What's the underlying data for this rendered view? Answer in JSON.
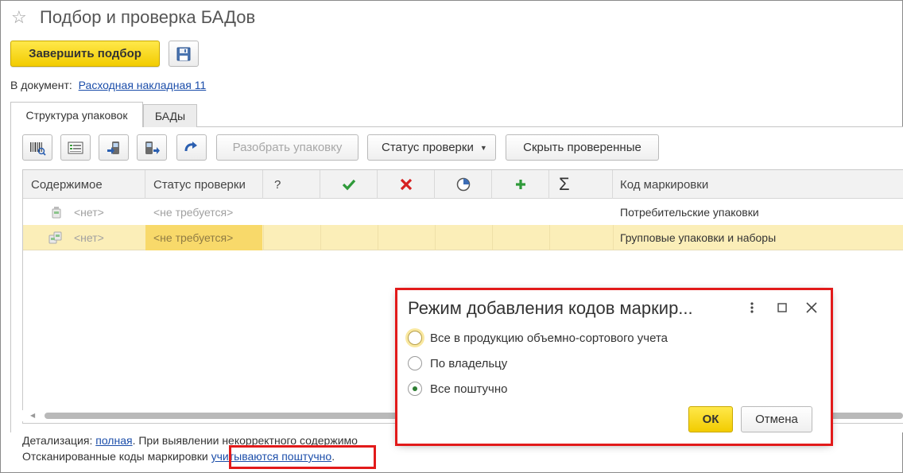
{
  "window": {
    "title": "Подбор и проверка БАДов"
  },
  "toolbar": {
    "finish_label": "Завершить подбор"
  },
  "document": {
    "label": "В документ:",
    "link": "Расходная накладная 11"
  },
  "tabs": [
    {
      "label": "Структура упаковок",
      "active": true
    },
    {
      "label": "БАДы",
      "active": false
    }
  ],
  "grid_toolbar": {
    "unpack_label": "Разобрать упаковку",
    "status_label": "Статус проверки",
    "hide_label": "Скрыть проверенные"
  },
  "table": {
    "headers": {
      "content": "Содержимое",
      "status": "Статус проверки",
      "question": "?",
      "code": "Код маркировки"
    },
    "rows": [
      {
        "content": "<нет>",
        "status": "<не требуется>",
        "code": "Потребительские упаковки",
        "selected": false
      },
      {
        "content": "<нет>",
        "status": "<не требуется>",
        "code": "Групповые упаковки и наборы",
        "selected": true
      }
    ]
  },
  "footer": {
    "detail_label": "Детализация:",
    "detail_link": "полная",
    "detail_text": ". При выявлении некорректного содержимо",
    "scanned_text": "Отсканированные коды маркировки ",
    "scanned_link": "учитываются поштучно",
    "scanned_end": "."
  },
  "dialog": {
    "title": "Режим добавления кодов маркир...",
    "options": [
      {
        "label": "Все в продукцию объемно-сортового учета",
        "checked": false
      },
      {
        "label": "По владельцу",
        "checked": false
      },
      {
        "label": "Все поштучно",
        "checked": true
      }
    ],
    "ok_label": "ОК",
    "cancel_label": "Отмена"
  },
  "colors": {
    "accent": "#f2cc00",
    "highlight_red": "#e21a1a",
    "selected_row": "#fbeeb8",
    "link": "#1c4eaa"
  }
}
